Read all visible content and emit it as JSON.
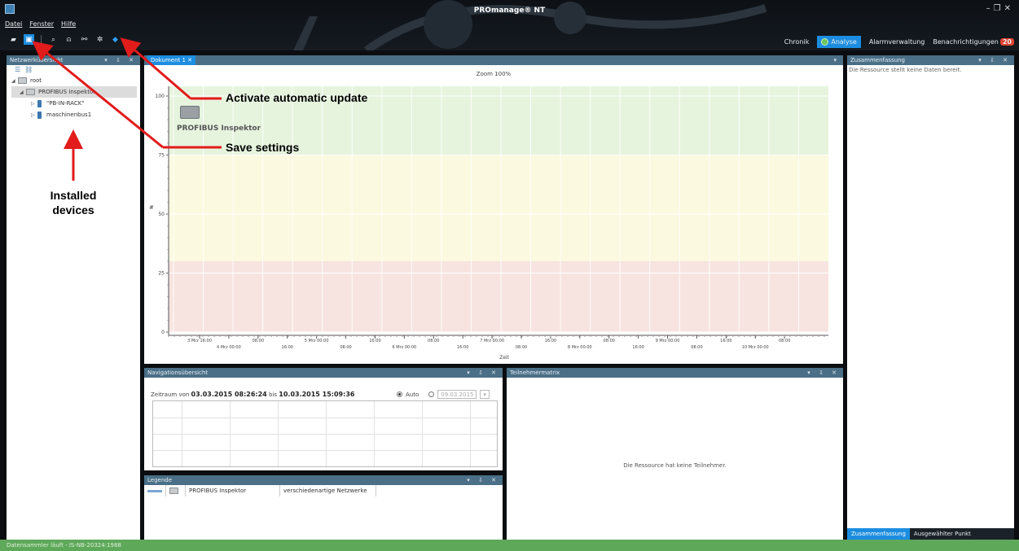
{
  "window": {
    "title": "PROmanage® NT"
  },
  "menu": {
    "items": [
      "Datei",
      "Fenster",
      "Hilfe"
    ]
  },
  "toolbar": {
    "icons": [
      "open-folder-icon",
      "save-icon",
      "zoom-icon",
      "pin-icon",
      "network-icon",
      "settings-icon",
      "refresh-icon"
    ]
  },
  "topnav": {
    "chronik": "Chronik",
    "analyse": "Analyse",
    "alarm": "Alarmverwaltung",
    "notifications": "Benachrichtigungen",
    "notification_count": "20"
  },
  "network_panel": {
    "title": "Netzwerkübersicht",
    "tree": [
      {
        "label": "root",
        "level": 0,
        "type": "folder"
      },
      {
        "label": "PROFIBUS Inspektor",
        "level": 1,
        "type": "folder",
        "selected": true
      },
      {
        "label": "\"PB-IN-RACK\"",
        "level": 2,
        "type": "device"
      },
      {
        "label": "maschinenbus1",
        "level": 2,
        "type": "device"
      }
    ]
  },
  "document_panel": {
    "tab": "Dokument 1",
    "zoom": "Zoom 100%",
    "resource_label": "PROFIBUS Inspektor"
  },
  "chart_data": {
    "type": "line",
    "xlabel": "Zeit",
    "ylabel": "#",
    "ylim": [
      0,
      100
    ],
    "y_ticks": [
      "0",
      "25",
      "50",
      "75",
      "100"
    ],
    "x_ticks_top": [
      "3 Mrz 16:00",
      "08:00",
      "5 Mrz 00:00",
      "16:00",
      "08:00",
      "7 Mrz 00:00",
      "16:00",
      "08:00",
      "9 Mrz 00:00",
      "16:00",
      "08:00"
    ],
    "x_ticks_bottom": [
      "4 Mrz 00:00",
      "16:00",
      "08:00",
      "6 Mrz 00:00",
      "16:00",
      "08:00",
      "8 Mrz 00:00",
      "16:00",
      "08:00",
      "10 Mrz 00:00"
    ],
    "bands": [
      {
        "from": 75,
        "to": 100,
        "color": "#e6f4de"
      },
      {
        "from": 30,
        "to": 75,
        "color": "#fbf9df"
      },
      {
        "from": 0,
        "to": 30,
        "color": "#f7e4e0"
      }
    ],
    "series": []
  },
  "navigation_panel": {
    "title": "Navigationsübersicht",
    "range_prefix": "Zeitraum von",
    "from": "03.03.2015 08:26:24",
    "between": "bis",
    "to": "10.03.2015 15:09:36",
    "auto_label": "Auto",
    "date_value": "09.03.2015"
  },
  "participants_panel": {
    "title": "Teilnehmermatrix",
    "message": "Die Ressource hat keine Teilnehmer."
  },
  "legend_panel": {
    "title": "Legende",
    "row": {
      "name": "PROFIBUS Inspektor",
      "description": "verschiedenartige Netzwerke"
    }
  },
  "summary_panel": {
    "title": "Zusammenfassung",
    "message": "Die Ressource stellt keine Daten bereit.",
    "tabs": [
      "Zusammenfassung",
      "Ausgewählter Punkt"
    ]
  },
  "status": {
    "text": "Datensammler läuft - IS-NB-20324:1988"
  },
  "annotations": {
    "update": "Activate automatic update",
    "save": "Save settings",
    "devices_line1": "Installed",
    "devices_line2": "devices"
  }
}
